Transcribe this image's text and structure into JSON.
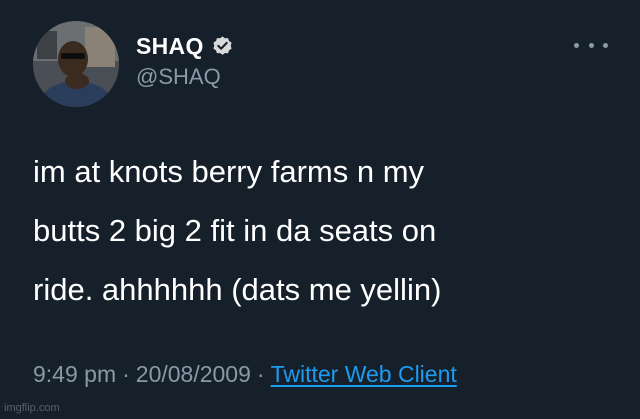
{
  "user": {
    "display_name": "SHAQ",
    "handle": "@SHAQ",
    "verified": true,
    "avatar_icon": "profile-photo"
  },
  "tweet": {
    "text_lines": [
      "im at knots berry farms n my",
      "butts 2 big 2 fit in da seats on",
      "ride. ahhhhhh (dats me yellin)"
    ],
    "time": "9:49 pm",
    "separator": "·",
    "date": "20/08/2009",
    "source": "Twitter Web Client"
  },
  "more_icon": "more-horizontal-icon",
  "watermark": "imgflip.com",
  "colors": {
    "background": "#15202b",
    "text": "#ffffff",
    "muted": "#8b98a5",
    "accent": "#1d9bf0"
  }
}
